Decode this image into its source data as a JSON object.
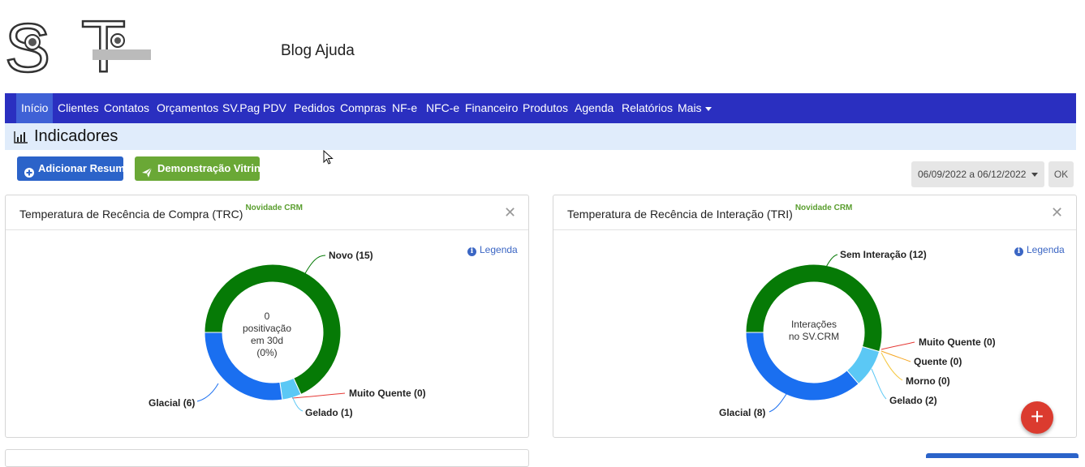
{
  "header": {
    "logo_letters": "ST",
    "blog_title": "Blog Ajuda"
  },
  "nav": {
    "items": [
      "Início",
      "Clientes",
      "Contatos",
      "Orçamentos",
      "SV.Pag",
      "PDV",
      "Pedidos",
      "Compras",
      "NF-e",
      "NFC-e",
      "Financeiro",
      "Produtos",
      "Agenda",
      "Relatórios",
      "Mais"
    ],
    "active": "Início"
  },
  "page": {
    "title": "Indicadores",
    "title_icon": "bar-chart-icon"
  },
  "actions": {
    "add_summary": "Adicionar Resumo",
    "add_summary_icon": "plus-circle-icon",
    "demo": "Demonstração Vitrine",
    "demo_icon": "paper-plane-icon",
    "date_range": "06/09/2022 a 06/12/2022",
    "ok": "OK"
  },
  "panels": {
    "trc": {
      "title": "Temperatura de Recência de Compra (TRC)",
      "badge": "Novidade CRM",
      "legend": "Legenda",
      "center_lines": [
        "0",
        "positivação",
        "em 30d",
        "(0%)"
      ],
      "labels": {
        "novo": "Novo (15)",
        "muito_quente": "Muito Quente (0)",
        "gelado": "Gelado (1)",
        "glacial": "Glacial (6)"
      }
    },
    "tri": {
      "title": "Temperatura de Recência de Interação (TRI)",
      "badge": "Novidade CRM",
      "legend": "Legenda",
      "center_lines": [
        "Interações",
        "no SV.CRM"
      ],
      "labels": {
        "sem_interacao": "Sem Interação (12)",
        "muito_quente": "Muito Quente (0)",
        "quente": "Quente (0)",
        "morno": "Morno (0)",
        "gelado": "Gelado (2)",
        "glacial": "Glacial (8)"
      }
    }
  },
  "chart_data": [
    {
      "type": "pie",
      "title": "Temperatura de Recência de Compra (TRC)",
      "categories": [
        "Novo",
        "Muito Quente",
        "Gelado",
        "Glacial"
      ],
      "values": [
        15,
        0,
        1,
        6
      ],
      "colors": [
        "#067a06",
        "#e53935",
        "#5bc8f5",
        "#1a6ff0"
      ]
    },
    {
      "type": "pie",
      "title": "Temperatura de Recência de Interação (TRI)",
      "categories": [
        "Sem Interação",
        "Muito Quente",
        "Quente",
        "Morno",
        "Gelado",
        "Glacial"
      ],
      "values": [
        12,
        0,
        0,
        0,
        2,
        8
      ],
      "colors": [
        "#067a06",
        "#e53935",
        "#f5a623",
        "#f5c842",
        "#5bc8f5",
        "#1a6ff0"
      ]
    }
  ],
  "fab": {
    "label": "+"
  }
}
